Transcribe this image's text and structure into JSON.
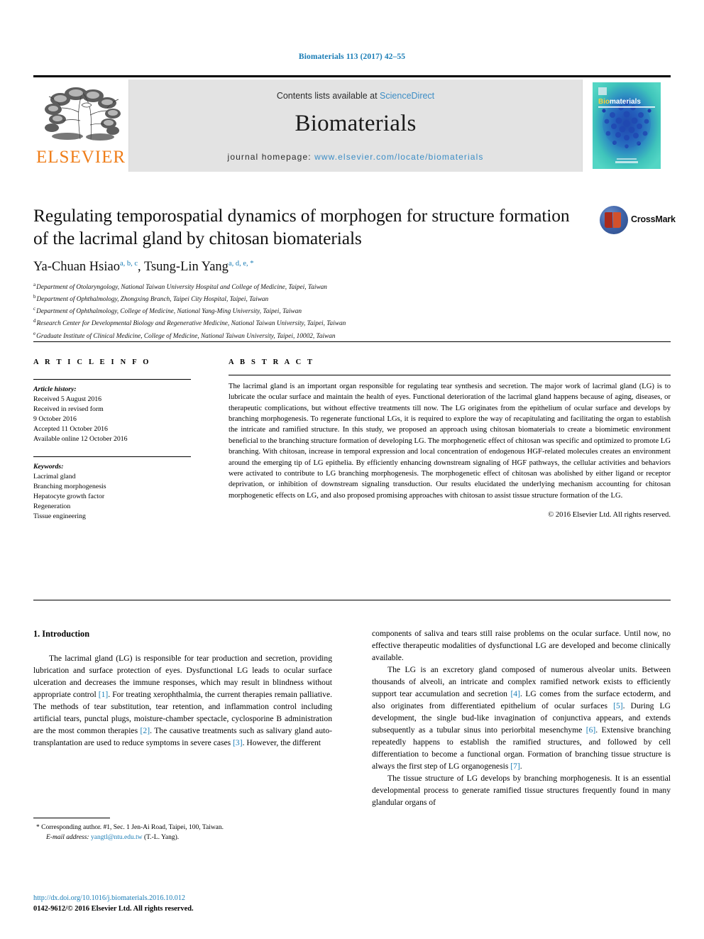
{
  "running_head": "Biomaterials 113 (2017) 42–55",
  "masthead": {
    "contents_prefix": "Contents lists available at ",
    "sciencedirect": "ScienceDirect",
    "journal_title": "Biomaterials",
    "homepage_label": "journal homepage: ",
    "homepage_url": "www.elsevier.com/locate/biomaterials",
    "publisher_name": "ELSEVIER",
    "cover_title": "Biomaterials"
  },
  "article": {
    "title": "Regulating temporospatial dynamics of morphogen for structure formation of the lacrimal gland by chitosan biomaterials",
    "authors": [
      {
        "name": "Ya-Chuan Hsiao",
        "marks": "a, b, c"
      },
      {
        "name": "Tsung-Lin Yang",
        "marks": "a, d, e, *"
      }
    ],
    "affiliations": [
      {
        "mark": "a",
        "text": "Department of Otolaryngology, National Taiwan University Hospital and College of Medicine, Taipei, Taiwan"
      },
      {
        "mark": "b",
        "text": "Department of Ophthalmology, Zhongxing Branch, Taipei City Hospital, Taipei, Taiwan"
      },
      {
        "mark": "c",
        "text": "Department of Ophthalmology, College of Medicine, National Yang-Ming University, Taipei, Taiwan"
      },
      {
        "mark": "d",
        "text": "Research Center for Developmental Biology and Regenerative Medicine, National Taiwan University, Taipei, Taiwan"
      },
      {
        "mark": "e",
        "text": "Graduate Institute of Clinical Medicine, College of Medicine, National Taiwan University, Taipei, 10002, Taiwan"
      }
    ],
    "crossmark_label": "CrossMark"
  },
  "article_info": {
    "heading": "A R T I C L E   I N F O",
    "history_label": "Article history:",
    "history": [
      "Received 5 August 2016",
      "Received in revised form",
      "9 October 2016",
      "Accepted 11 October 2016",
      "Available online 12 October 2016"
    ],
    "keywords_label": "Keywords:",
    "keywords": [
      "Lacrimal gland",
      "Branching morphogenesis",
      "Hepatocyte growth factor",
      "Regeneration",
      "Tissue engineering"
    ]
  },
  "abstract": {
    "heading": "A B S T R A C T",
    "body": "The lacrimal gland is an important organ responsible for regulating tear synthesis and secretion. The major work of lacrimal gland (LG) is to lubricate the ocular surface and maintain the health of eyes. Functional deterioration of the lacrimal gland happens because of aging, diseases, or therapeutic complications, but without effective treatments till now. The LG originates from the epithelium of ocular surface and develops by branching morphogenesis. To regenerate functional LGs, it is required to explore the way of recapitulating and facilitating the organ to establish the intricate and ramified structure. In this study, we proposed an approach using chitosan biomaterials to create a biomimetic environment beneficial to the branching structure formation of developing LG. The morphogenetic effect of chitosan was specific and optimized to promote LG branching. With chitosan, increase in temporal expression and local concentration of endogenous HGF-related molecules creates an environment around the emerging tip of LG epithelia. By efficiently enhancing downstream signaling of HGF pathways, the cellular activities and behaviors were activated to contribute to LG branching morphogenesis. The morphogenetic effect of chitosan was abolished by either ligand or receptor deprivation, or inhibition of downstream signaling transduction. Our results elucidated the underlying mechanism accounting for chitosan morphogenetic effects on LG, and also proposed promising approaches with chitosan to assist tissue structure formation of the LG.",
    "copyright": "© 2016 Elsevier Ltd. All rights reserved."
  },
  "introduction": {
    "heading": "1. Introduction",
    "left_paragraph_1_a": "The lacrimal gland (LG) is responsible for tear production and secretion, providing lubrication and surface protection of eyes. Dysfunctional LG leads to ocular surface ulceration and decreases the immune responses, which may result in blindness without appropriate control ",
    "ref1": "[1]",
    "left_paragraph_1_b": ". For treating xerophthalmia, the current therapies remain palliative. The methods of tear substitution, tear retention, and inflammation control including artificial tears, punctal plugs, moisture-chamber spectacle, cyclosporine B administration are the most common therapies ",
    "ref2": "[2]",
    "left_paragraph_1_c": ". The causative treatments such as salivary gland auto-transplantation are used to reduce symptoms in severe cases ",
    "ref3": "[3]",
    "left_paragraph_1_d": ". However, the different",
    "right_paragraph_1": "components of saliva and tears still raise problems on the ocular surface. Until now, no effective therapeutic modalities of dysfunctional LG are developed and become clinically available.",
    "right_paragraph_2_a": "The LG is an excretory gland composed of numerous alveolar units. Between thousands of alveoli, an intricate and complex ramified network exists to efficiently support tear accumulation and secretion ",
    "ref4": "[4]",
    "right_paragraph_2_b": ". LG comes from the surface ectoderm, and also originates from differentiated epithelium of ocular surfaces ",
    "ref5": "[5]",
    "right_paragraph_2_c": ". During LG development, the single bud-like invagination of conjunctiva appears, and extends subsequently as a tubular sinus into periorbital mesenchyme ",
    "ref6": "[6]",
    "right_paragraph_2_d": ". Extensive branching repeatedly happens to establish the ramified structures, and followed by cell differentiation to become a functional organ. Formation of branching tissue structure is always the first step of LG organogenesis ",
    "ref7": "[7]",
    "right_paragraph_2_e": ".",
    "right_paragraph_3": "The tissue structure of LG develops by branching morphogenesis. It is an essential developmental process to generate ramified tissue structures frequently found in many glandular organs of"
  },
  "footnote": {
    "star": "*",
    "corresponding": "Corresponding author. #1, Sec. 1 Jen-Ai Road, Taipei, 100, Taiwan.",
    "email_label": "E-mail address:",
    "email": "yangtl@ntu.edu.tw",
    "email_suffix": "(T.-L. Yang)."
  },
  "footer": {
    "doi": "http://dx.doi.org/10.1016/j.biomaterials.2016.10.012",
    "issn_line": "0142-9612/© 2016 Elsevier Ltd. All rights reserved."
  },
  "colors": {
    "link_blue": "#1a7db6",
    "sciencedirect_blue": "#3c8dc5",
    "elsevier_orange": "#ef7d18",
    "masthead_gray": "#e3e3e3"
  }
}
